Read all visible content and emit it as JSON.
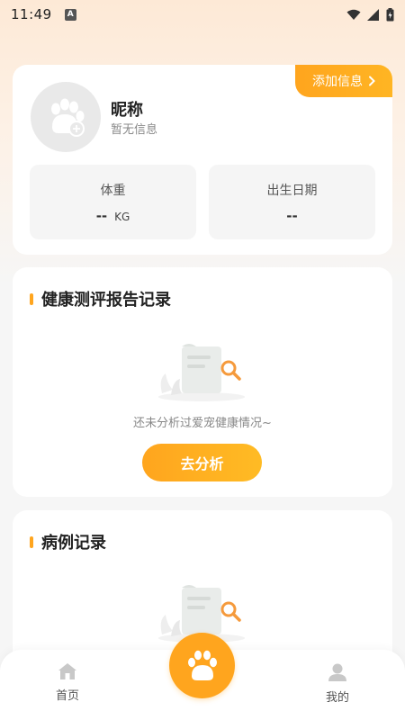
{
  "status_bar": {
    "time": "11:49",
    "indicator": "A"
  },
  "profile": {
    "add_info_label": "添加信息",
    "nickname": "昵称",
    "no_info": "暂无信息",
    "weight_label": "体重",
    "weight_value": "--",
    "weight_unit": "KG",
    "birth_label": "出生日期",
    "birth_value": "--"
  },
  "health_section": {
    "title": "健康测评报告记录",
    "empty_text": "还未分析过爱宠健康情况~",
    "button_label": "去分析"
  },
  "case_section": {
    "title": "病例记录"
  },
  "tabbar": {
    "home_label": "首页",
    "mine_label": "我的"
  },
  "colors": {
    "accent": "#ffa51e",
    "card_bg": "#ffffff",
    "stat_bg": "#f5f5f5"
  }
}
